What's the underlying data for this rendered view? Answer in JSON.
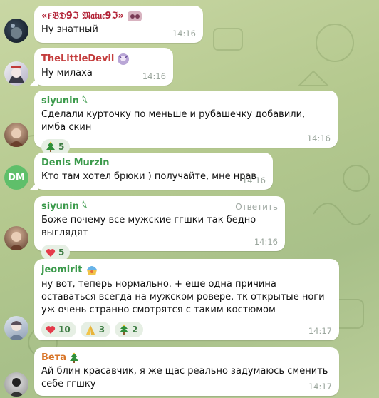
{
  "messages": [
    {
      "name": "«ꜰ𝔅𝔇9ℑ 𝔐𝔞𝔱𝔲𝔠9ℑ»",
      "name_color": "#b22236",
      "text": "Ну знатный",
      "time": "14:16",
      "reply": "",
      "reactions": []
    },
    {
      "name": "TheLittleDevil",
      "name_color": "#c43d3d",
      "text": "Ну милаха",
      "time": "14:16",
      "reply": "",
      "reactions": []
    },
    {
      "name": "siyunin 𓆩",
      "name_color": "#3b9a4b",
      "text": "Сделали курточку по меньше и рубашечку добавили, имба скин",
      "time": "14:16",
      "reply": "",
      "reactions": [
        {
          "emoji": "tree-emoji",
          "count": "5"
        }
      ]
    },
    {
      "name": "Denis Murzin",
      "name_color": "#3b9a4b",
      "text": "Кто там хотел брюки ) получайте, мне нрав",
      "time": "14:16",
      "reply": "",
      "reactions": []
    },
    {
      "name": "siyunin 𓆩",
      "name_color": "#3b9a4b",
      "text": "Боже почему все мужские ггшки так бедно выглядят",
      "time": "14:16",
      "reply": "Ответить",
      "reactions": [
        {
          "emoji": "heart-emoji",
          "count": "5"
        }
      ]
    },
    {
      "name": "jeomirit",
      "name_color": "#3b9a4b",
      "text": "ну вот, теперь нормально. + еще одна причина оставаться всегда на мужском ровере. тк открытые ноги уж очень странно смотрятся с таким костюмом",
      "time": "14:17",
      "reply": "",
      "reactions": [
        {
          "emoji": "heart-emoji",
          "count": "10"
        },
        {
          "emoji": "pray-emoji",
          "count": "3"
        },
        {
          "emoji": "tree-emoji",
          "count": "2"
        }
      ]
    },
    {
      "name": "Вета",
      "name_color": "#d9772b",
      "text": "Ай блин красавчик, я же щас реально задумаюсь сменить себе ггшку",
      "time": "14:17",
      "reply": "",
      "reactions": []
    }
  ],
  "avatars": {
    "denis_initials": "DM"
  },
  "colors": {
    "bubble": "#ffffff",
    "reaction_bg": "#e6efe4",
    "time": "#9aa59c",
    "avatar_dm": "#5fbf6a"
  }
}
